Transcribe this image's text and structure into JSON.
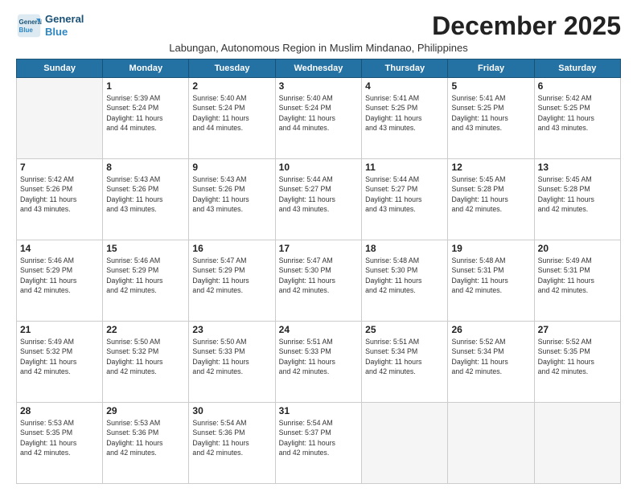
{
  "header": {
    "logo_general": "General",
    "logo_blue": "Blue",
    "month": "December 2025",
    "location": "Labungan, Autonomous Region in Muslim Mindanao, Philippines"
  },
  "columns": [
    "Sunday",
    "Monday",
    "Tuesday",
    "Wednesday",
    "Thursday",
    "Friday",
    "Saturday"
  ],
  "weeks": [
    [
      {
        "day": "",
        "info": ""
      },
      {
        "day": "1",
        "info": "Sunrise: 5:39 AM\nSunset: 5:24 PM\nDaylight: 11 hours\nand 44 minutes."
      },
      {
        "day": "2",
        "info": "Sunrise: 5:40 AM\nSunset: 5:24 PM\nDaylight: 11 hours\nand 44 minutes."
      },
      {
        "day": "3",
        "info": "Sunrise: 5:40 AM\nSunset: 5:24 PM\nDaylight: 11 hours\nand 44 minutes."
      },
      {
        "day": "4",
        "info": "Sunrise: 5:41 AM\nSunset: 5:25 PM\nDaylight: 11 hours\nand 43 minutes."
      },
      {
        "day": "5",
        "info": "Sunrise: 5:41 AM\nSunset: 5:25 PM\nDaylight: 11 hours\nand 43 minutes."
      },
      {
        "day": "6",
        "info": "Sunrise: 5:42 AM\nSunset: 5:25 PM\nDaylight: 11 hours\nand 43 minutes."
      }
    ],
    [
      {
        "day": "7",
        "info": "Sunrise: 5:42 AM\nSunset: 5:26 PM\nDaylight: 11 hours\nand 43 minutes."
      },
      {
        "day": "8",
        "info": "Sunrise: 5:43 AM\nSunset: 5:26 PM\nDaylight: 11 hours\nand 43 minutes."
      },
      {
        "day": "9",
        "info": "Sunrise: 5:43 AM\nSunset: 5:26 PM\nDaylight: 11 hours\nand 43 minutes."
      },
      {
        "day": "10",
        "info": "Sunrise: 5:44 AM\nSunset: 5:27 PM\nDaylight: 11 hours\nand 43 minutes."
      },
      {
        "day": "11",
        "info": "Sunrise: 5:44 AM\nSunset: 5:27 PM\nDaylight: 11 hours\nand 43 minutes."
      },
      {
        "day": "12",
        "info": "Sunrise: 5:45 AM\nSunset: 5:28 PM\nDaylight: 11 hours\nand 42 minutes."
      },
      {
        "day": "13",
        "info": "Sunrise: 5:45 AM\nSunset: 5:28 PM\nDaylight: 11 hours\nand 42 minutes."
      }
    ],
    [
      {
        "day": "14",
        "info": "Sunrise: 5:46 AM\nSunset: 5:29 PM\nDaylight: 11 hours\nand 42 minutes."
      },
      {
        "day": "15",
        "info": "Sunrise: 5:46 AM\nSunset: 5:29 PM\nDaylight: 11 hours\nand 42 minutes."
      },
      {
        "day": "16",
        "info": "Sunrise: 5:47 AM\nSunset: 5:29 PM\nDaylight: 11 hours\nand 42 minutes."
      },
      {
        "day": "17",
        "info": "Sunrise: 5:47 AM\nSunset: 5:30 PM\nDaylight: 11 hours\nand 42 minutes."
      },
      {
        "day": "18",
        "info": "Sunrise: 5:48 AM\nSunset: 5:30 PM\nDaylight: 11 hours\nand 42 minutes."
      },
      {
        "day": "19",
        "info": "Sunrise: 5:48 AM\nSunset: 5:31 PM\nDaylight: 11 hours\nand 42 minutes."
      },
      {
        "day": "20",
        "info": "Sunrise: 5:49 AM\nSunset: 5:31 PM\nDaylight: 11 hours\nand 42 minutes."
      }
    ],
    [
      {
        "day": "21",
        "info": "Sunrise: 5:49 AM\nSunset: 5:32 PM\nDaylight: 11 hours\nand 42 minutes."
      },
      {
        "day": "22",
        "info": "Sunrise: 5:50 AM\nSunset: 5:32 PM\nDaylight: 11 hours\nand 42 minutes."
      },
      {
        "day": "23",
        "info": "Sunrise: 5:50 AM\nSunset: 5:33 PM\nDaylight: 11 hours\nand 42 minutes."
      },
      {
        "day": "24",
        "info": "Sunrise: 5:51 AM\nSunset: 5:33 PM\nDaylight: 11 hours\nand 42 minutes."
      },
      {
        "day": "25",
        "info": "Sunrise: 5:51 AM\nSunset: 5:34 PM\nDaylight: 11 hours\nand 42 minutes."
      },
      {
        "day": "26",
        "info": "Sunrise: 5:52 AM\nSunset: 5:34 PM\nDaylight: 11 hours\nand 42 minutes."
      },
      {
        "day": "27",
        "info": "Sunrise: 5:52 AM\nSunset: 5:35 PM\nDaylight: 11 hours\nand 42 minutes."
      }
    ],
    [
      {
        "day": "28",
        "info": "Sunrise: 5:53 AM\nSunset: 5:35 PM\nDaylight: 11 hours\nand 42 minutes."
      },
      {
        "day": "29",
        "info": "Sunrise: 5:53 AM\nSunset: 5:36 PM\nDaylight: 11 hours\nand 42 minutes."
      },
      {
        "day": "30",
        "info": "Sunrise: 5:54 AM\nSunset: 5:36 PM\nDaylight: 11 hours\nand 42 minutes."
      },
      {
        "day": "31",
        "info": "Sunrise: 5:54 AM\nSunset: 5:37 PM\nDaylight: 11 hours\nand 42 minutes."
      },
      {
        "day": "",
        "info": ""
      },
      {
        "day": "",
        "info": ""
      },
      {
        "day": "",
        "info": ""
      }
    ]
  ]
}
